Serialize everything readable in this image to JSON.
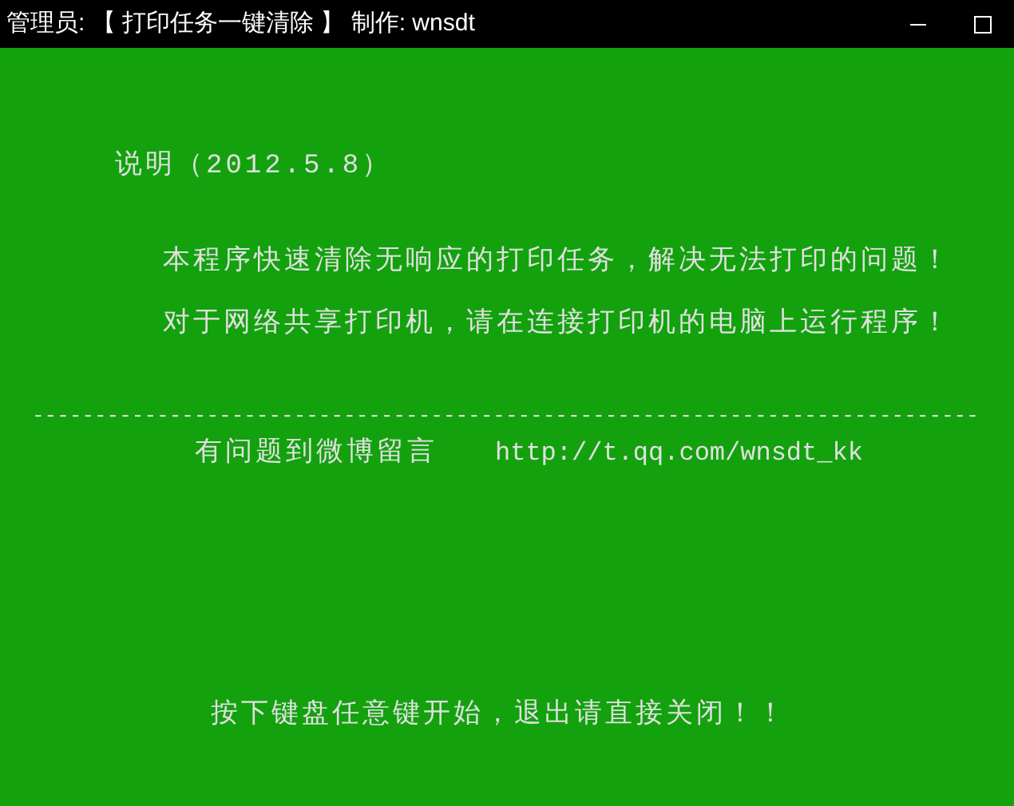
{
  "window": {
    "title": "管理员: 【 打印任务一键清除 】 制作: wnsdt"
  },
  "console": {
    "heading": "说明（2012.5.8）",
    "lines": [
      "本程序快速清除无响应的打印任务，解决无法打印的问题！",
      "对于网络共享打印机，请在连接打印机的电脑上运行程序！"
    ],
    "separator": "----------------------------------------------------------------------------",
    "contact": {
      "label": "有问题到微博留言",
      "url": "http://t.qq.com/wnsdt_kk"
    },
    "prompt": "按下键盘任意键开始，退出请直接关闭！！"
  }
}
